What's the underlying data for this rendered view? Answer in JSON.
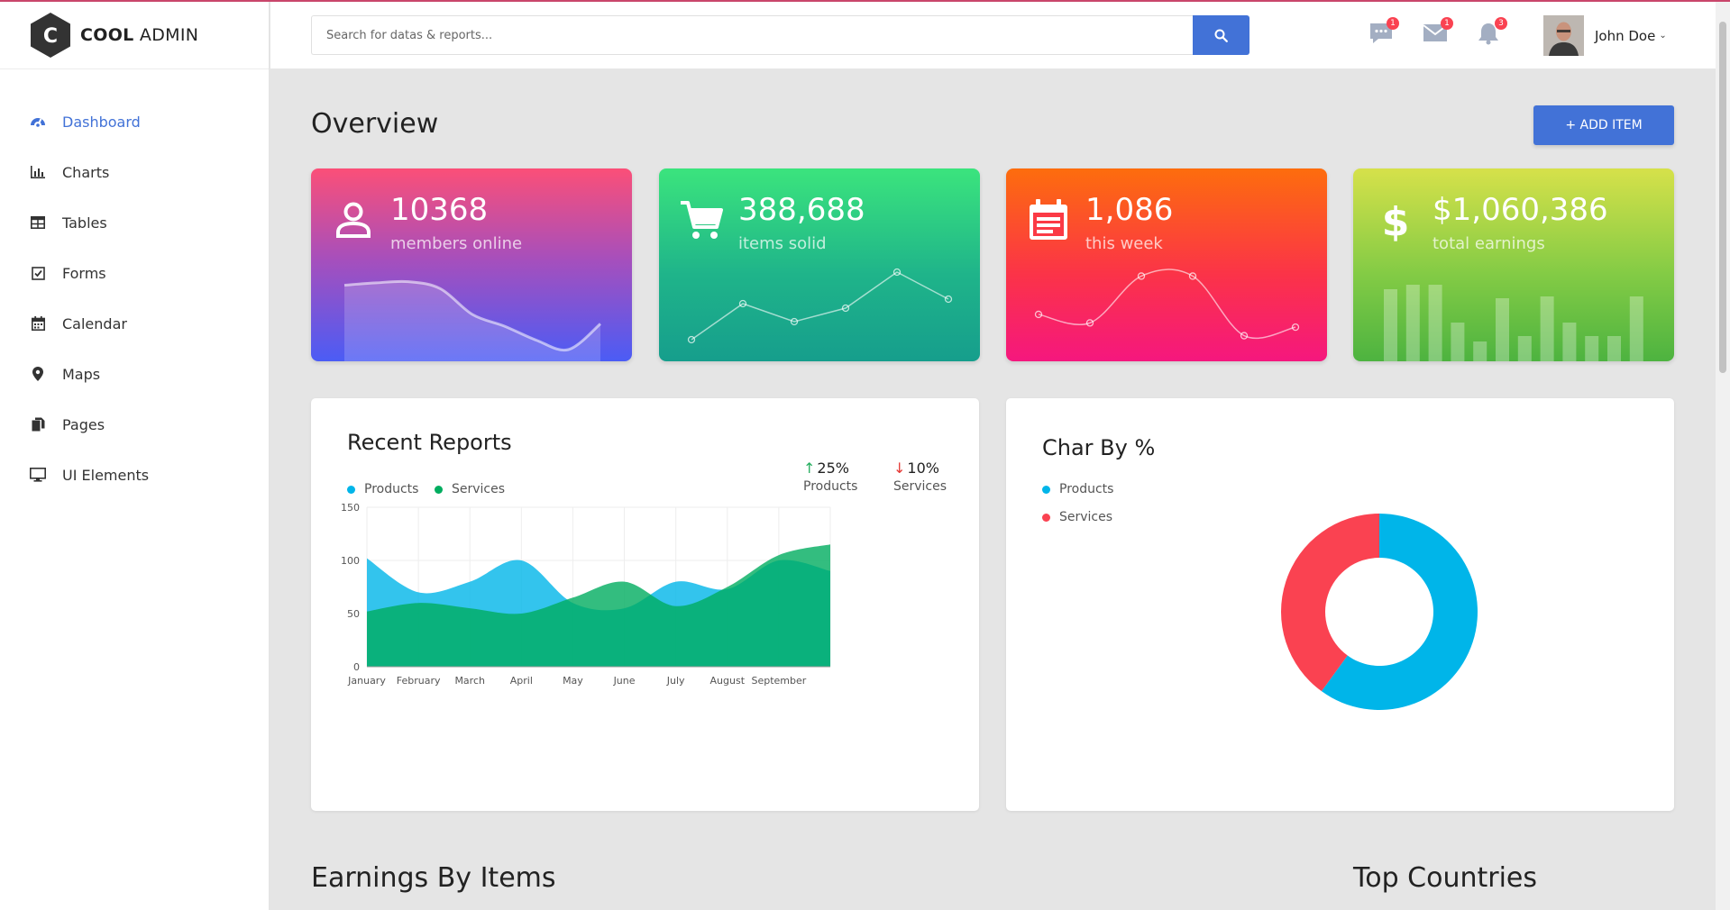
{
  "app": {
    "logo_bold": "COOL",
    "logo_rest": " ADMIN",
    "logo_letter": "C"
  },
  "sidebar": {
    "items": [
      {
        "label": "Dashboard",
        "icon": "dashboard-icon",
        "active": true
      },
      {
        "label": "Charts",
        "icon": "bar-chart-icon"
      },
      {
        "label": "Tables",
        "icon": "table-icon"
      },
      {
        "label": "Forms",
        "icon": "checkbox-icon"
      },
      {
        "label": "Calendar",
        "icon": "calendar-icon"
      },
      {
        "label": "Maps",
        "icon": "map-marker-icon"
      },
      {
        "label": "Pages",
        "icon": "copy-icon"
      },
      {
        "label": "UI Elements",
        "icon": "desktop-icon"
      }
    ]
  },
  "header": {
    "search_placeholder": "Search for datas & reports...",
    "notifications": {
      "comments": "1",
      "mail": "1",
      "bell": "3"
    },
    "user_name": "John Doe",
    "user_caret": "⌄"
  },
  "page": {
    "title": "Overview",
    "add_button": "+ ADD ITEM",
    "section_earnings": "Earnings By Items",
    "section_countries": "Top Countries"
  },
  "stats": [
    {
      "value": "10368",
      "label": "members online",
      "icon": "account-icon"
    },
    {
      "value": "388,688",
      "label": "items solid",
      "icon": "shopping-cart-icon"
    },
    {
      "value": "1,086",
      "label": "this week",
      "icon": "calendar-note-icon"
    },
    {
      "value": "$1,060,386",
      "label": "total earnings",
      "icon": "money-icon"
    }
  ],
  "recent_reports": {
    "title": "Recent Reports",
    "legend": [
      "Products",
      "Services"
    ],
    "products_change": "25%",
    "services_change": "10%",
    "products_label": "Products",
    "services_label": "Services"
  },
  "pie_card": {
    "title": "Char By %",
    "legend": [
      "Products",
      "Services"
    ]
  },
  "colors": {
    "accent": "#4272d7",
    "products": "#00b5e9",
    "services": "#fa4251",
    "services_area": "#00ad5f",
    "badge": "#fa4251"
  },
  "chart_data": [
    {
      "type": "area",
      "title": "Recent Reports",
      "categories": [
        "January",
        "February",
        "March",
        "April",
        "May",
        "June",
        "July",
        "August",
        "September",
        ""
      ],
      "ylim": [
        0,
        150
      ],
      "yticks": [
        0,
        50,
        100,
        150
      ],
      "grid": true,
      "series": [
        {
          "name": "Products",
          "values": [
            102,
            70,
            80,
            100,
            60,
            55,
            80,
            73,
            100,
            90
          ]
        },
        {
          "name": "Services",
          "values": [
            52,
            60,
            55,
            50,
            65,
            80,
            57,
            75,
            105,
            115
          ]
        }
      ]
    },
    {
      "type": "pie",
      "title": "Char By %",
      "labels": [
        "Products",
        "Services"
      ],
      "values": [
        60,
        40
      ]
    },
    {
      "type": "area",
      "title": "members online",
      "values": [
        65,
        67,
        68,
        62,
        40,
        30,
        18,
        10,
        32
      ]
    },
    {
      "type": "line",
      "title": "items solid",
      "values": [
        0,
        40,
        20,
        35,
        75,
        45
      ]
    },
    {
      "type": "line",
      "title": "this week",
      "values": [
        35,
        25,
        80,
        80,
        10,
        20
      ]
    },
    {
      "type": "bar",
      "title": "total earnings",
      "values": [
        80,
        85,
        85,
        43,
        22,
        70,
        28,
        72,
        43,
        28,
        28,
        72
      ]
    }
  ]
}
